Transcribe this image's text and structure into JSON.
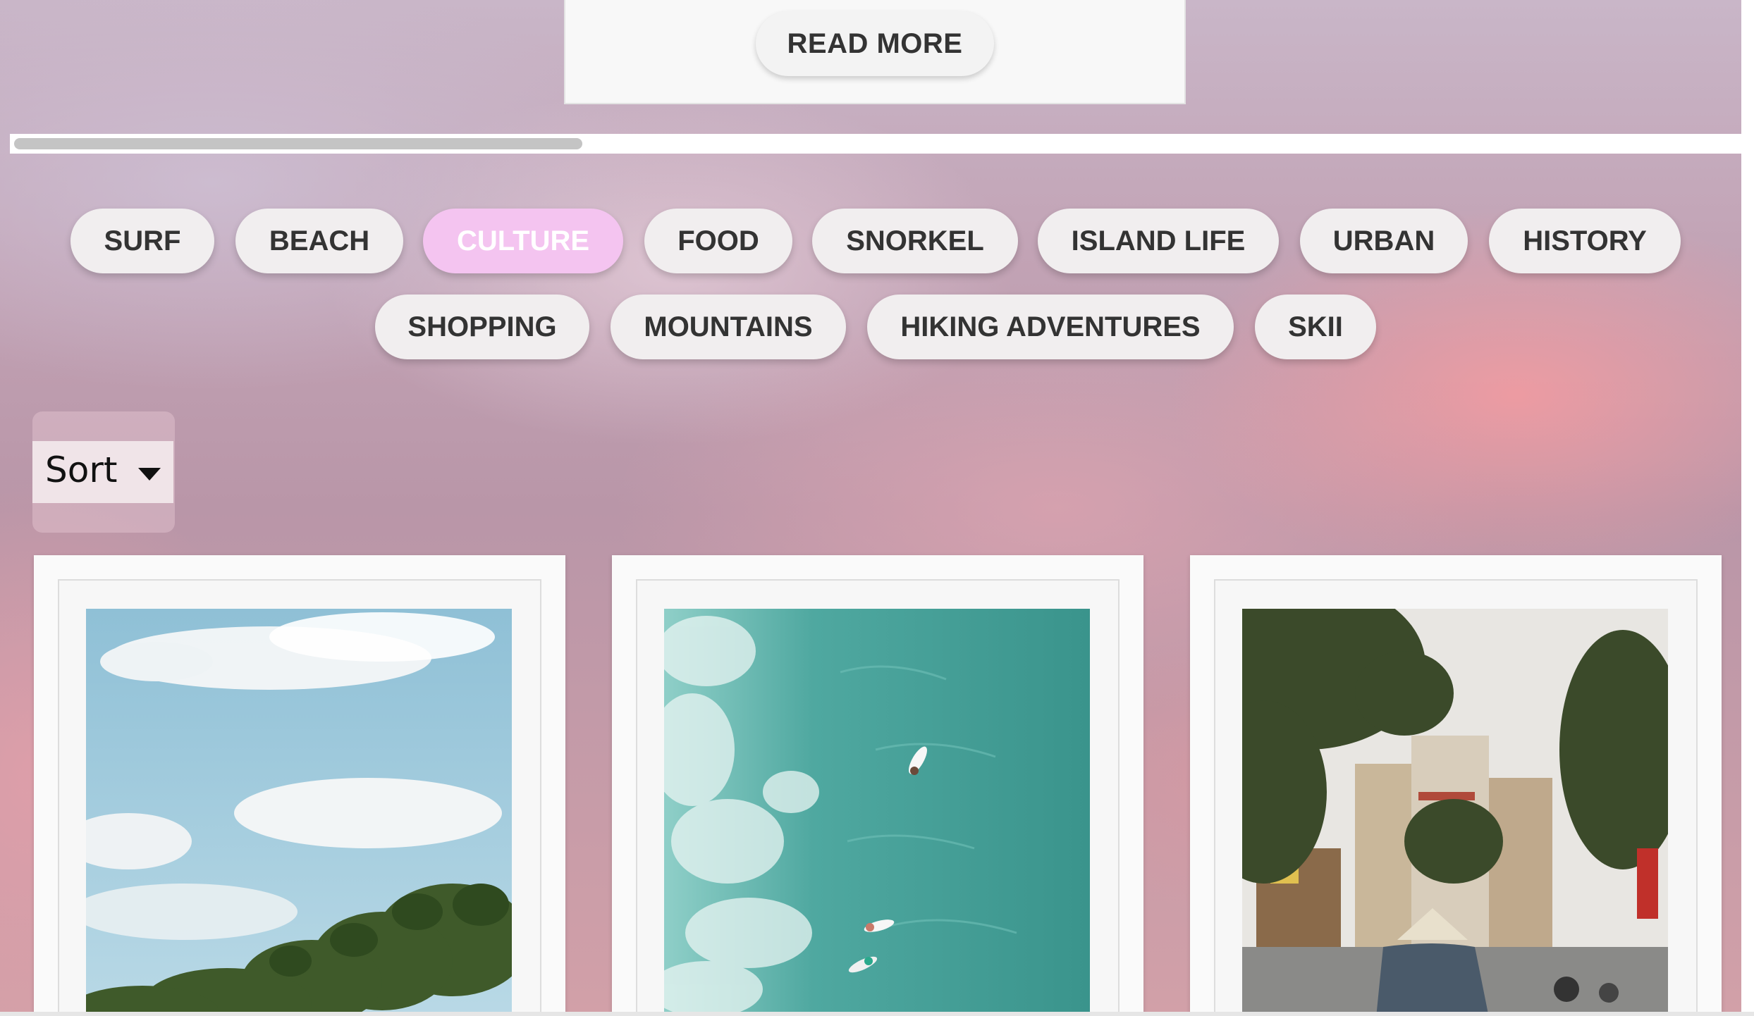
{
  "carousel": {
    "read_more_label": "READ MORE"
  },
  "categories": [
    {
      "label": "SURF",
      "active": false
    },
    {
      "label": "BEACH",
      "active": false
    },
    {
      "label": "CULTURE",
      "active": true
    },
    {
      "label": "FOOD",
      "active": false
    },
    {
      "label": "SNORKEL",
      "active": false
    },
    {
      "label": "ISLAND LIFE",
      "active": false
    },
    {
      "label": "URBAN",
      "active": false
    },
    {
      "label": "HISTORY",
      "active": false
    },
    {
      "label": "SHOPPING",
      "active": false
    },
    {
      "label": "MOUNTAINS",
      "active": false
    },
    {
      "label": "HIKING ADVENTURES",
      "active": false
    },
    {
      "label": "SKII",
      "active": false
    }
  ],
  "sort": {
    "label": "Sort",
    "icon": "caret-down-icon"
  },
  "cards": [
    {
      "photo": "palm-beach-photo"
    },
    {
      "photo": "surfers-aerial-photo"
    },
    {
      "photo": "city-street-photo"
    }
  ],
  "colors": {
    "active_chip": "#f4c4f0",
    "chip": "#f1eeef",
    "chip_text": "#333333"
  }
}
